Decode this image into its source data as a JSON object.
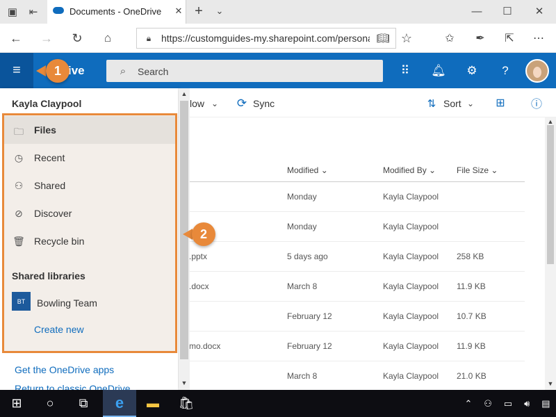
{
  "browser": {
    "tab_title": "Documents - OneDrive",
    "url": "https://customguides-my.sharepoint.com/personal/s"
  },
  "header": {
    "brand": "ive",
    "search_placeholder": "Search"
  },
  "commandbar": {
    "partial_label": "low",
    "sync_label": "Sync",
    "sort_label": "Sort"
  },
  "list": {
    "columns": [
      "Modified",
      "Modified By",
      "File Size"
    ],
    "rows": [
      {
        "name": "",
        "modified": "Monday",
        "by": "Kayla Claypool",
        "size": ""
      },
      {
        "name": "",
        "modified": "Monday",
        "by": "Kayla Claypool",
        "size": ""
      },
      {
        "name": ".pptx",
        "modified": "5 days ago",
        "by": "Kayla Claypool",
        "size": "258 KB"
      },
      {
        "name": ".docx",
        "modified": "March 8",
        "by": "Kayla Claypool",
        "size": "11.9 KB"
      },
      {
        "name": "",
        "modified": "February 12",
        "by": "Kayla Claypool",
        "size": "10.7 KB"
      },
      {
        "name": "mo.docx",
        "modified": "February 12",
        "by": "Kayla Claypool",
        "size": "11.9 KB"
      },
      {
        "name": "",
        "modified": "March 8",
        "by": "Kayla Claypool",
        "size": "21.0 KB"
      }
    ]
  },
  "panel": {
    "user": "Kayla Claypool",
    "nav": [
      {
        "label": "Files",
        "icon": "folder-icon",
        "selected": true
      },
      {
        "label": "Recent",
        "icon": "history-icon"
      },
      {
        "label": "Shared",
        "icon": "shared-icon"
      },
      {
        "label": "Discover",
        "icon": "discover-icon"
      },
      {
        "label": "Recycle bin",
        "icon": "recycle-bin-icon"
      }
    ],
    "shared_libraries_heading": "Shared libraries",
    "library_initials": "BT",
    "library_name": "Bowling Team",
    "create_new": "Create new",
    "get_apps": "Get the OneDrive apps",
    "return_link": "Return to classic OneDrive"
  },
  "callouts": [
    "1",
    "2"
  ],
  "colors": {
    "accent": "#0f6cbd",
    "callout": "#e8893a",
    "highlight_bg": "#f3eee9"
  }
}
